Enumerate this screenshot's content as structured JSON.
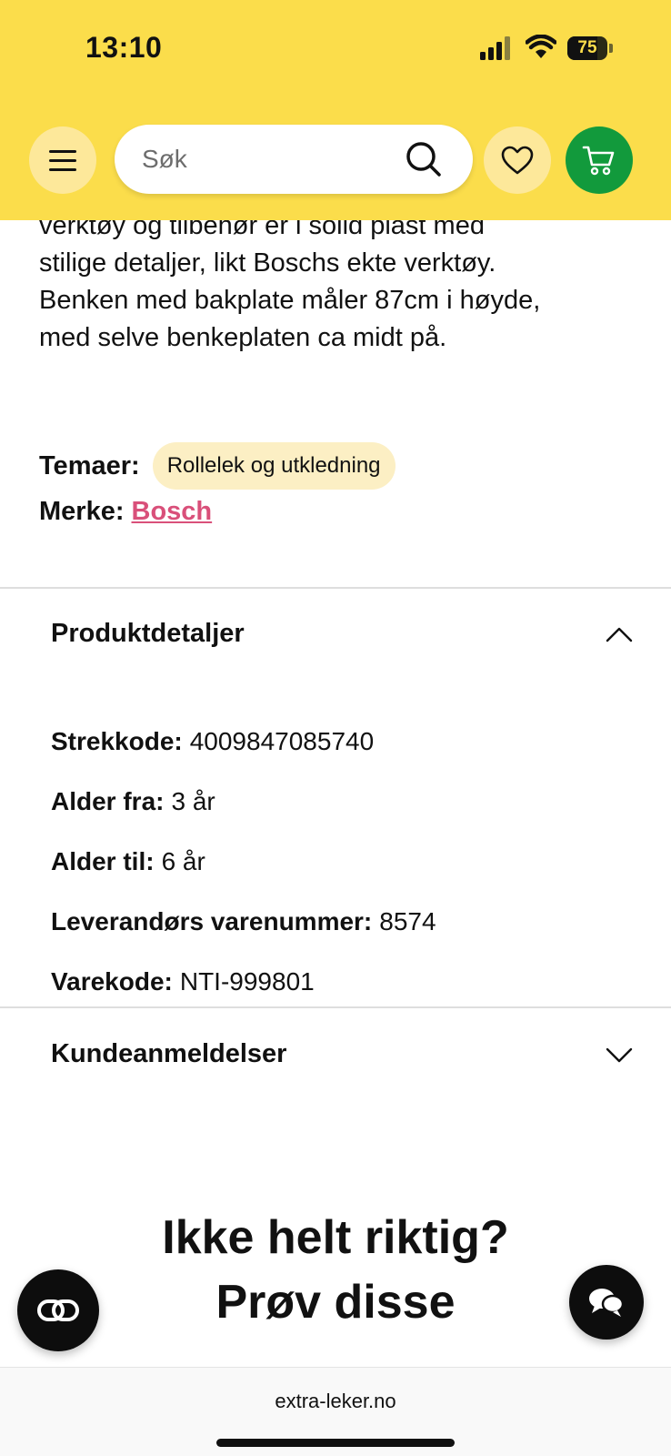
{
  "status_bar": {
    "time": "13:10",
    "battery": "75",
    "battery_level": 0.75
  },
  "header": {
    "search": {
      "placeholder": "Søk"
    },
    "icons": [
      "menu-icon",
      "search-icon",
      "heart-icon",
      "cart-icon"
    ],
    "colors": {
      "background": "#fbdd4b",
      "cart_button": "#129a3c"
    }
  },
  "description": {
    "lines": [
      "verktøy og tilbehør er i solid plast med",
      "stilige detaljer, likt Boschs ekte verktøy.",
      "Benken med bakplate måler 87cm i høyde,",
      "med selve benkeplaten ca midt på."
    ]
  },
  "meta": {
    "themes_label": "Temaer:",
    "theme_tag": "Rollelek og utkledning",
    "brand_label": "Merke:",
    "brand": "Bosch",
    "brand_color": "#d9507a"
  },
  "product_details": {
    "title": "Produktdetaljer",
    "expanded": true,
    "rows": [
      {
        "label": "Strekkode:",
        "value": "4009847085740"
      },
      {
        "label": "Alder fra:",
        "value": "3 år"
      },
      {
        "label": "Alder til:",
        "value": "6 år"
      },
      {
        "label": "Leverandørs varenummer:",
        "value": "8574"
      },
      {
        "label": "Varekode:",
        "value": "NTI-999801"
      }
    ]
  },
  "reviews": {
    "title": "Kundeanmeldelser",
    "expanded": false
  },
  "suggestions": {
    "line1": "Ikke helt riktig?",
    "line2": "Prøv disse"
  },
  "floating_buttons": [
    "link-icon",
    "chat-icon"
  ],
  "browser": {
    "url": "extra-leker.no"
  }
}
